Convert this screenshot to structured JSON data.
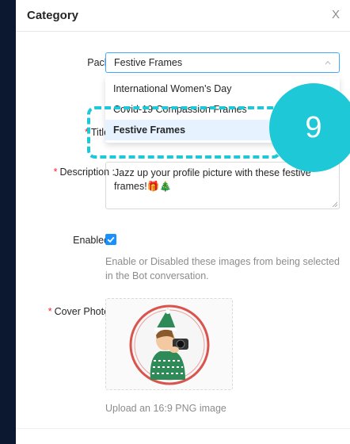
{
  "modal": {
    "title": "Category",
    "close_label": "X"
  },
  "form": {
    "pack": {
      "label": "Pack :",
      "value": "Festive Frames",
      "options": [
        "International Women's Day",
        "Covid-19 Compassion Frames",
        "Festive Frames"
      ],
      "selected_index": 2
    },
    "title": {
      "required_mark": "*",
      "label": "Title :",
      "value": ""
    },
    "description": {
      "required_mark": "*",
      "label": "Description :",
      "value": "Jazz up your profile picture with these festive frames!🎁🎄"
    },
    "enabled": {
      "label": "Enabled :",
      "checked": true,
      "helper": "Enable or Disabled these images from being selected in the Bot conversation."
    },
    "cover_photo": {
      "required_mark": "*",
      "label": "Cover Photo :",
      "hint": "Upload an 16:9 PNG image"
    }
  },
  "annotation": {
    "step_number": "9",
    "color": "#1ec8d6"
  },
  "colors": {
    "primary": "#1890ff",
    "required": "#f5222d",
    "backdrop": "#0b1830"
  }
}
